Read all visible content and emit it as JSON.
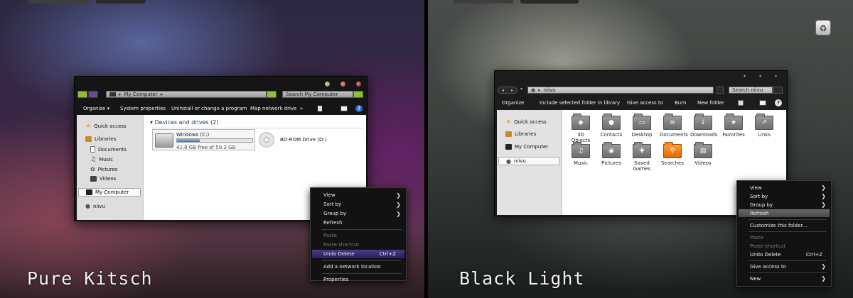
{
  "left": {
    "caption": "Pure Kitsch",
    "window": {
      "address": "My Computer",
      "search_placeholder": "Search My Computer",
      "toolbar": [
        "Organize ▾",
        "System properties",
        "Uninstall or change a program",
        "Map network drive",
        "»"
      ],
      "nav": [
        {
          "label": "Quick access",
          "icon": "star-icon"
        },
        {
          "label": "Libraries",
          "icon": "library-icon"
        },
        {
          "label": "Documents",
          "icon": "document-icon"
        },
        {
          "label": "Music",
          "icon": "music-icon"
        },
        {
          "label": "Pictures",
          "icon": "picture-icon"
        },
        {
          "label": "Videos",
          "icon": "video-icon"
        },
        {
          "label": "My Computer",
          "icon": "computer-icon"
        },
        {
          "label": "niivu",
          "icon": "user-icon"
        }
      ],
      "section_title": "Devices and drives (2)",
      "drives": [
        {
          "name": "Windows (C:)",
          "free": "41.8 GB free of 59.3 GB",
          "used_fraction": 0.3
        },
        {
          "name": "BD-ROM Drive (D:)"
        }
      ]
    },
    "context_menu": [
      {
        "label": "View",
        "submenu": true
      },
      {
        "label": "Sort by",
        "submenu": true
      },
      {
        "label": "Group by",
        "submenu": true
      },
      {
        "label": "Refresh"
      },
      {
        "sep": true
      },
      {
        "label": "Paste",
        "disabled": true
      },
      {
        "label": "Paste shortcut",
        "disabled": true
      },
      {
        "label": "Undo Delete",
        "shortcut": "Ctrl+Z",
        "highlight": true
      },
      {
        "sep": true
      },
      {
        "label": "Add a network location"
      },
      {
        "sep": true
      },
      {
        "label": "Properties"
      }
    ]
  },
  "right": {
    "caption": "Black Light",
    "window": {
      "address": "niivu",
      "search_placeholder": "Search niivu",
      "toolbar": [
        "Organize",
        "Include selected folder in library",
        "Give access to",
        "Burn",
        "New folder"
      ],
      "nav": [
        {
          "label": "Quick access",
          "icon": "star-icon"
        },
        {
          "label": "Libraries",
          "icon": "library-icon"
        },
        {
          "label": "My Computer",
          "icon": "computer-icon"
        },
        {
          "label": "niivu",
          "icon": "user-icon"
        }
      ],
      "folders": [
        {
          "label": "3D Objects",
          "glyph": "◆"
        },
        {
          "label": "Contacts",
          "glyph": "●"
        },
        {
          "label": "Desktop",
          "glyph": "▭"
        },
        {
          "label": "Documents",
          "glyph": "≡"
        },
        {
          "label": "Downloads",
          "glyph": "↓"
        },
        {
          "label": "Favorites",
          "glyph": "★"
        },
        {
          "label": "Links",
          "glyph": "↗"
        },
        {
          "label": "Music",
          "glyph": "♫"
        },
        {
          "label": "Pictures",
          "glyph": "◉"
        },
        {
          "label": "Saved Games",
          "glyph": "✚"
        },
        {
          "label": "Searches",
          "glyph": "⚲",
          "orange": true
        },
        {
          "label": "Videos",
          "glyph": "▤"
        }
      ]
    },
    "context_menu": [
      {
        "label": "View",
        "submenu": true
      },
      {
        "label": "Sort by",
        "submenu": true
      },
      {
        "label": "Group by",
        "submenu": true
      },
      {
        "label": "Refresh",
        "highlight": true
      },
      {
        "sep": true
      },
      {
        "label": "Customize this folder..."
      },
      {
        "sep": true
      },
      {
        "label": "Paste",
        "disabled": true
      },
      {
        "label": "Paste shortcut",
        "disabled": true
      },
      {
        "label": "Undo Delete",
        "shortcut": "Ctrl+Z"
      },
      {
        "sep": true
      },
      {
        "label": "Give access to",
        "submenu": true
      },
      {
        "sep": true
      },
      {
        "label": "New",
        "submenu": true
      }
    ]
  },
  "colors": {
    "accent_left": "#8fbf3a",
    "highlight_left": "#3a2a6a",
    "highlight_right": "#5a5a5a",
    "accent_orange": "#f07d10"
  }
}
